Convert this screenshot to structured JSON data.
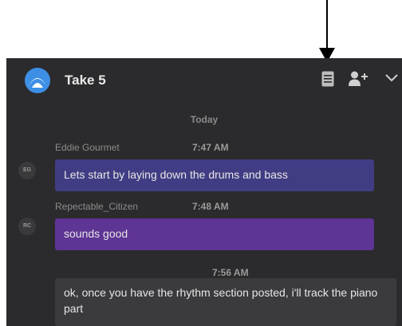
{
  "header": {
    "title": "Take 5",
    "icons": {
      "logo": "app-logo",
      "notes": "notes-icon",
      "add_user": "add-user-icon",
      "menu": "chevron-down-icon"
    }
  },
  "chat": {
    "day_label": "Today",
    "messages": [
      {
        "author": "Eddie Gourmet",
        "initials": "EG",
        "time": "7:47 AM",
        "text": "Lets start by laying down the drums and bass",
        "color": "#413d84"
      },
      {
        "author": "Repectable_Citizen",
        "initials": "RC",
        "time": "7:48 AM",
        "text": "sounds good",
        "color": "#5e3494"
      },
      {
        "author": "",
        "initials": "",
        "time": "7:56 AM",
        "text": "ok, once you have the rhythm section posted, i'll track the piano part",
        "color": "#3b3b3e"
      }
    ]
  },
  "colors": {
    "panel_bg": "#2b2b2d",
    "logo_blue": "#3d8fe6"
  }
}
